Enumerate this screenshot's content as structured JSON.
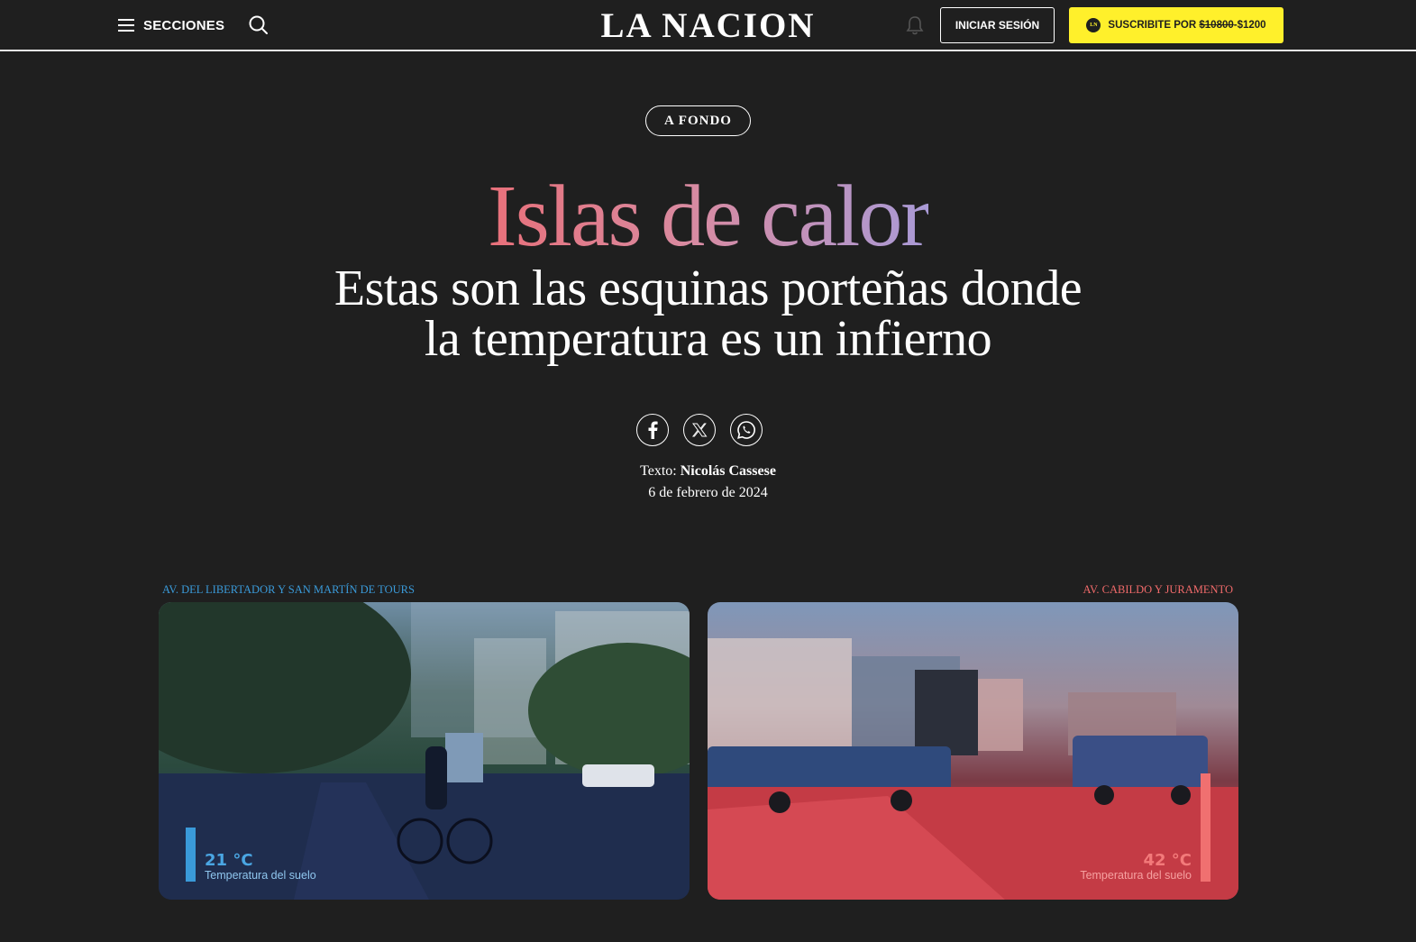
{
  "header": {
    "menu_label": "SECCIONES",
    "logo": "LA NACION",
    "login_label": "INICIAR SESIÓN",
    "subscribe_prefix": "SUSCRIBITE POR",
    "subscribe_old_price": "$10800",
    "subscribe_new_price": "-$1200",
    "subscribe_logo_text": "LN"
  },
  "article": {
    "tag": "A FONDO",
    "title": "Islas de calor",
    "subtitle_line1": "Estas son las esquinas porteñas donde",
    "subtitle_line2": "la temperatura es un infierno",
    "byline_prefix": "Texto:",
    "author": "Nicolás Cassese",
    "date": "6 de febrero de 2024"
  },
  "shares": [
    "facebook-icon",
    "x-icon",
    "whatsapp-icon"
  ],
  "comparison": {
    "left": {
      "caption": "AV. DEL LIBERTADOR Y SAN MARTÍN DE TOURS",
      "temperature": "21 °C",
      "label": "Temperatura del suelo",
      "color": "#3a9ad9"
    },
    "right": {
      "caption": "AV. CABILDO Y JURAMENTO",
      "temperature": "42 °C",
      "label": "Temperatura del suelo",
      "color": "#f07070"
    }
  },
  "colors": {
    "background": "#1f1f1f",
    "subscribe_bg": "#fff02b",
    "title_gradient_start": "#e8707a",
    "title_gradient_end": "#a99ad6"
  }
}
